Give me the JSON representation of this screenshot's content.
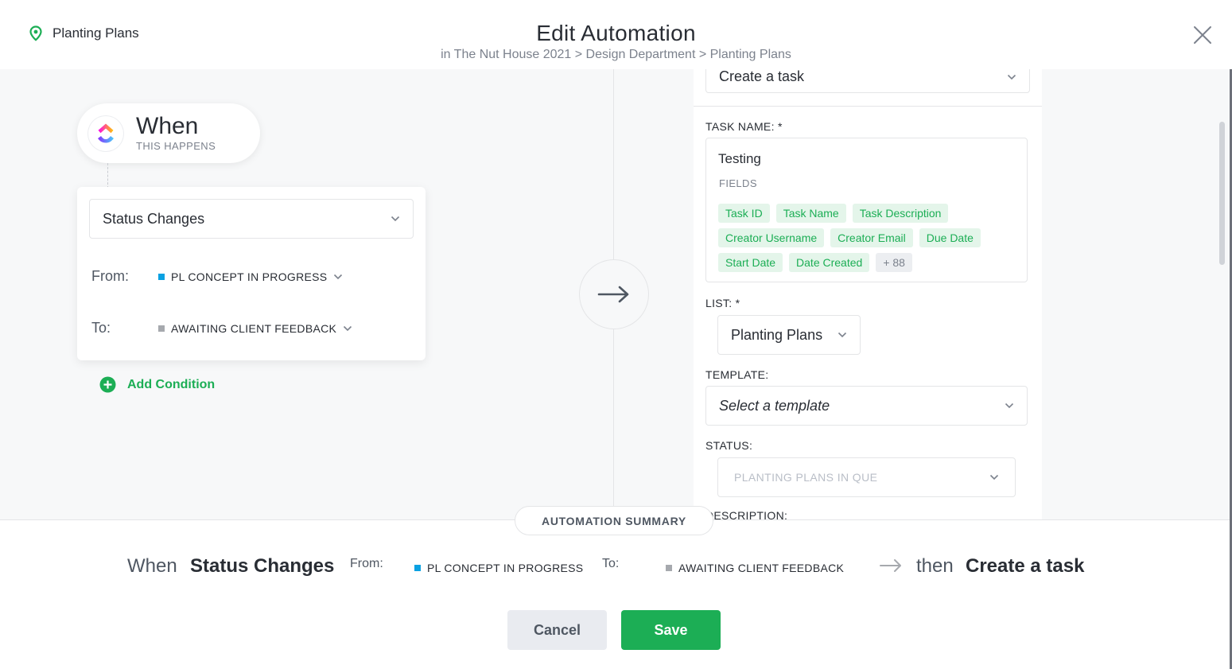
{
  "header": {
    "location": "Planting Plans",
    "title": "Edit Automation",
    "breadcrumb": "in The Nut House 2021 > Design Department > Planting Plans"
  },
  "trigger": {
    "when_title": "When",
    "when_subtitle": "THIS HAPPENS",
    "event": "Status Changes",
    "from_label": "From:",
    "from_status": "PL CONCEPT IN PROGRESS",
    "from_color": "#0aa1e2",
    "to_label": "To:",
    "to_status": "AWAITING CLIENT FEEDBACK",
    "to_color": "#a6a9ae",
    "add_condition": "Add Condition"
  },
  "action": {
    "type": "Create a task",
    "task_name_label": "TASK NAME: *",
    "task_name_value": "Testing",
    "fields_label": "FIELDS",
    "fields": [
      "Task ID",
      "Task Name",
      "Task Description",
      "Creator Username",
      "Creator Email",
      "Due Date",
      "Start Date",
      "Date Created"
    ],
    "fields_more": "+ 88",
    "list_label": "LIST: *",
    "list_value": "Planting Plans",
    "template_label": "TEMPLATE:",
    "template_placeholder": "Select a template",
    "status_label": "STATUS:",
    "status_value": "PLANTING PLANS IN QUE",
    "description_label": "DESCRIPTION:"
  },
  "summary": {
    "pill": "AUTOMATION SUMMARY",
    "when": "When",
    "trigger": "Status Changes",
    "from_label": "From:",
    "from_status": "PL CONCEPT IN PROGRESS",
    "to_label": "To:",
    "to_status": "AWAITING CLIENT FEEDBACK",
    "then": "then",
    "action": "Create a task"
  },
  "buttons": {
    "cancel": "Cancel",
    "save": "Save"
  },
  "colors": {
    "accent_green": "#1cae55",
    "chip_bg": "#e4f5ea"
  }
}
